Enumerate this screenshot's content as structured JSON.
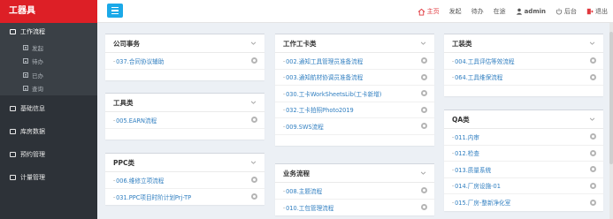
{
  "brand": "工器具",
  "nav": {
    "home": "主页",
    "launch": "发起",
    "todo": "待办",
    "in_progress": "在途",
    "user": "admin",
    "backend": "后台",
    "logout": "退出"
  },
  "sidebar": {
    "items": [
      {
        "label": "工作流程",
        "children": [
          "发起",
          "待办",
          "已办",
          "查询"
        ]
      },
      {
        "label": "基础信息"
      },
      {
        "label": "库房数据"
      },
      {
        "label": "预约管理"
      },
      {
        "label": "计量管理"
      }
    ]
  },
  "panels": {
    "company": {
      "title": "公司事务",
      "links": [
        "037.合同协议辅助"
      ]
    },
    "tools": {
      "title": "工具类",
      "links": [
        "005.EARN流程"
      ]
    },
    "ppc": {
      "title": "PPC类",
      "links": [
        "006.维修立项流程",
        "031.PPC项目时阶计划Prj-TP"
      ]
    },
    "workcard": {
      "title": "工作工卡类",
      "links": [
        "002.通知工具管理员准备流程",
        "003.通知航材协调员准备流程",
        "030.工卡WorkSheetsLib(工卡新增)",
        "032.工卡拍照Photo2019",
        "009.SWS流程"
      ]
    },
    "business": {
      "title": "业务流程",
      "links": [
        "008.主题流程",
        "010.工包管理流程"
      ]
    },
    "tooling": {
      "title": "工装类",
      "links": [
        "004.工具评估等效流程",
        "064.工具维保流程"
      ]
    },
    "qa": {
      "title": "QA类",
      "links": [
        "011.内审",
        "012.检查",
        "013.质量系统",
        "014.厂房设施-01",
        "015.厂房-整新净化室"
      ]
    }
  },
  "colors": {
    "brand_red": "#dd1f26",
    "accent_blue": "#1ba9e8",
    "link_blue": "#2f7ec0",
    "sidebar_bg": "#2d3238"
  }
}
